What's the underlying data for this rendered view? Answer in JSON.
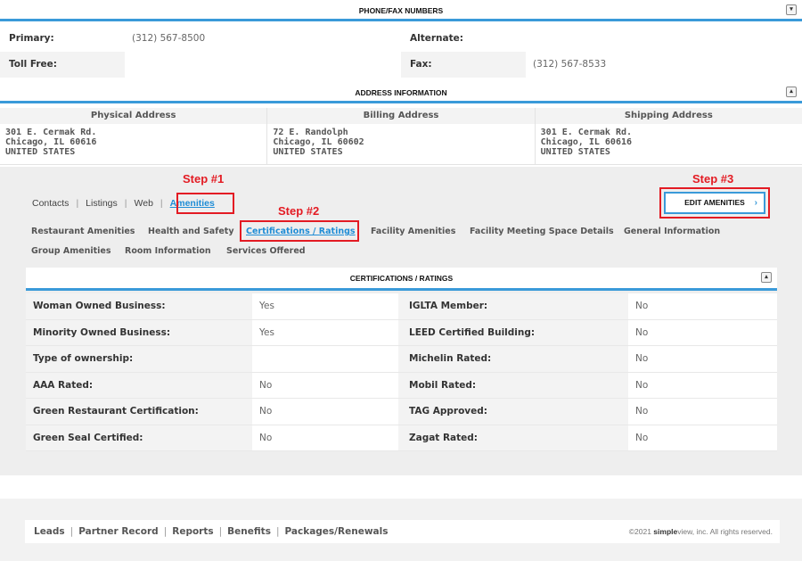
{
  "phone_section": {
    "title": "PHONE/FAX NUMBERS",
    "toggle": "▾",
    "rows": [
      {
        "label1": "Primary:",
        "value1": "(312) 567-8500",
        "label2": "Alternate:",
        "value2": ""
      },
      {
        "label1": "Toll Free:",
        "value1": "",
        "label2": "Fax:",
        "value2": "(312) 567-8533"
      }
    ]
  },
  "address_section": {
    "title": "ADDRESS INFORMATION",
    "toggle": "▴",
    "columns": [
      {
        "title": "Physical Address",
        "line1": "301 E. Cermak Rd.",
        "line2": "Chicago, IL 60616",
        "line3": "UNITED STATES"
      },
      {
        "title": "Billing Address",
        "line1": "72 E. Randolph",
        "line2": "Chicago, IL 60602",
        "line3": "UNITED STATES"
      },
      {
        "title": "Shipping Address",
        "line1": "301 E. Cermak Rd.",
        "line2": "Chicago, IL 60616",
        "line3": "UNITED STATES"
      }
    ]
  },
  "steps": {
    "step1": "Step #1",
    "step2": "Step #2",
    "step3": "Step #3"
  },
  "tabs": [
    "Contacts",
    "Listings",
    "Web",
    "Amenities"
  ],
  "tab_separator": "|",
  "edit_button": {
    "label": "EDIT AMENITIES",
    "chevron": "›"
  },
  "subtabs": [
    "Restaurant Amenities",
    "Health and Safety",
    "Certifications / Ratings",
    "Facility Amenities",
    "Facility Meeting Space Details",
    "General Information",
    "Group Amenities",
    "Room Information",
    "Services Offered"
  ],
  "cert_section": {
    "title": "CERTIFICATIONS / RATINGS",
    "toggle": "▴",
    "rows": [
      {
        "label1": "Woman Owned Business:",
        "value1": "Yes",
        "label2": "IGLTA Member:",
        "value2": "No"
      },
      {
        "label1": "Minority Owned Business:",
        "value1": "Yes",
        "label2": "LEED Certified Building:",
        "value2": "No"
      },
      {
        "label1": "Type of ownership:",
        "value1": "",
        "label2": "Michelin Rated:",
        "value2": "No"
      },
      {
        "label1": "AAA Rated:",
        "value1": "No",
        "label2": "Mobil Rated:",
        "value2": "No"
      },
      {
        "label1": "Green Restaurant Certification:",
        "value1": "No",
        "label2": "TAG Approved:",
        "value2": "No"
      },
      {
        "label1": "Green Seal Certified:",
        "value1": "No",
        "label2": "Zagat Rated:",
        "value2": "No"
      }
    ]
  },
  "footer": {
    "links": [
      "Leads",
      "Partner Record",
      "Reports",
      "Benefits",
      "Packages/Renewals"
    ],
    "separator": "|",
    "copyright_prefix": "©2021 ",
    "brand": "simple",
    "copyright_suffix": "view, inc. All rights reserved."
  }
}
